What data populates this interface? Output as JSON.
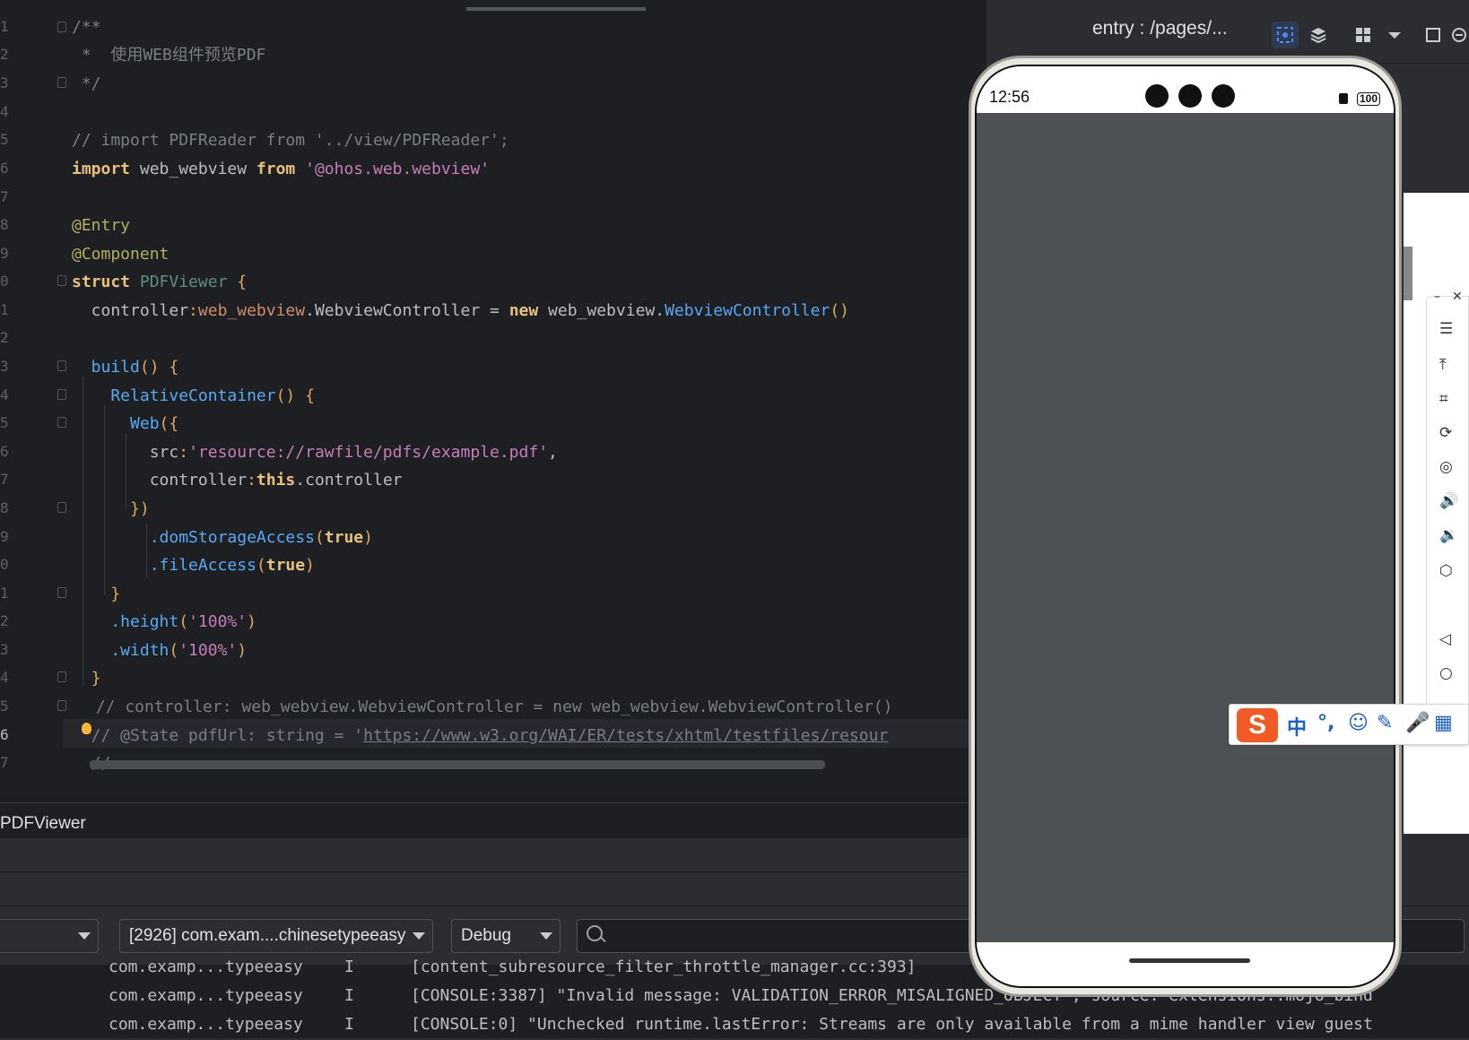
{
  "editor": {
    "line_numbers": [
      "1",
      "2",
      "3",
      "4",
      "5",
      "6",
      "7",
      "8",
      "9",
      "0",
      "1",
      "2",
      "3",
      "4",
      "5",
      "6",
      "7",
      "8",
      "9",
      "0",
      "1",
      "2",
      "3",
      "4",
      "5",
      "6",
      "7"
    ],
    "code": {
      "l1": "/**",
      "l2": " *  使用WEB组件预览PDF",
      "l3": " */",
      "l5": "// import PDFReader from '../view/PDFReader';",
      "l6_kw1": "import",
      "l6_id": " web_webview ",
      "l6_kw2": "from",
      "l6_str": " '@ohos.web.webview'",
      "l8": "@Entry",
      "l9": "@Component",
      "l10_kw": "struct",
      "l10_name": " PDFViewer ",
      "l10_brace": "{",
      "l11_a": "  controller",
      "l11_b": ":",
      "l11_c": "web_webview",
      "l11_d": ".WebviewController = ",
      "l11_e": "new",
      "l11_f": " web_webview.",
      "l11_g": "WebviewController",
      "l11_h": "()",
      "l13_fn": "  build",
      "l13_p": "()",
      "l13_b": " {",
      "l14_fn": "    RelativeContainer",
      "l14_p": "()",
      "l14_b": " {",
      "l15_fn": "      Web",
      "l15_p": "({",
      "l16_a": "        src",
      "l16_b": ":",
      "l16_c": "'resource://rawfile/pdfs/example.pdf'",
      "l16_d": ",",
      "l17_a": "        controller",
      "l17_b": ":",
      "l17_c": "this",
      "l17_d": ".controller",
      "l18": "      })",
      "l19_fn": "        .domStorageAccess",
      "l19_p1": "(",
      "l19_v": "true",
      "l19_p2": ")",
      "l20_fn": "        .fileAccess",
      "l20_p1": "(",
      "l20_v": "true",
      "l20_p2": ")",
      "l21": "    }",
      "l22_fn": "    .height",
      "l22_p1": "(",
      "l22_v": "'100%'",
      "l22_p2": ")",
      "l23_fn": "    .width",
      "l23_p1": "(",
      "l23_v": "'100%'",
      "l23_p2": ")",
      "l24": "  }",
      "l25": " // controller: web_webview.WebviewController = new web_webview.WebviewController()",
      "l26_a": "  // @State pdfUrl: string = '",
      "l26_b": "https://www.w3.org/WAI/ER/tests/xhtml/testfiles/resour",
      "l27": "  //"
    }
  },
  "breadcrumb": "PDFViewer",
  "logcat": {
    "device_combo": "",
    "process_combo": "[2926] com.exam....chinesetypeeasy",
    "level_combo": "Debug",
    "rows": [
      {
        "tag": "com.examp...typeeasy",
        "level": "I",
        "msg": "[content_subresource_filter_throttle_manager.cc:393]"
      },
      {
        "tag": "com.examp...typeeasy",
        "level": "I",
        "msg": "[CONSOLE:3387] \"Invalid message: VALIDATION_ERROR_MISALIGNED_OBJECT\", source: extensions::mojo_bind"
      },
      {
        "tag": "com.examp...typeeasy",
        "level": "I",
        "msg": "[CONSOLE:0] \"Unchecked runtime.lastError: Streams are only available from a mime handler view guest"
      }
    ]
  },
  "previewer": {
    "title": "entry : /pages/...",
    "phone_time": "12:56",
    "battery": "100"
  },
  "ime": {
    "logo": "S",
    "lang": "中"
  }
}
